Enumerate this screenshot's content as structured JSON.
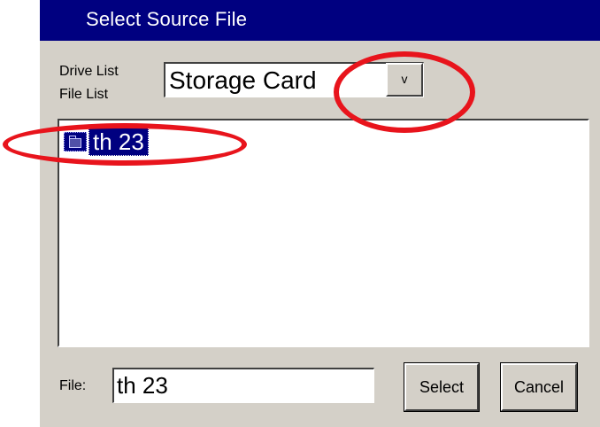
{
  "window": {
    "title": "Select Source File"
  },
  "drive_list": {
    "label": "Drive List",
    "selected_value": "Storage Card",
    "dropdown_button_label": "v"
  },
  "file_list": {
    "label": "File List",
    "items": [
      {
        "label": "th 23",
        "icon": "folder-icon",
        "selected": true
      }
    ]
  },
  "file_field": {
    "label": "File:",
    "value": "th 23"
  },
  "buttons": {
    "select_label": "Select",
    "cancel_label": "Cancel"
  },
  "annotations": {
    "color": "#e8141c",
    "shape": "ellipse"
  },
  "colors": {
    "titlebar": "#000080",
    "dialog_background": "#d4d0c8",
    "selection_background": "#000080"
  }
}
